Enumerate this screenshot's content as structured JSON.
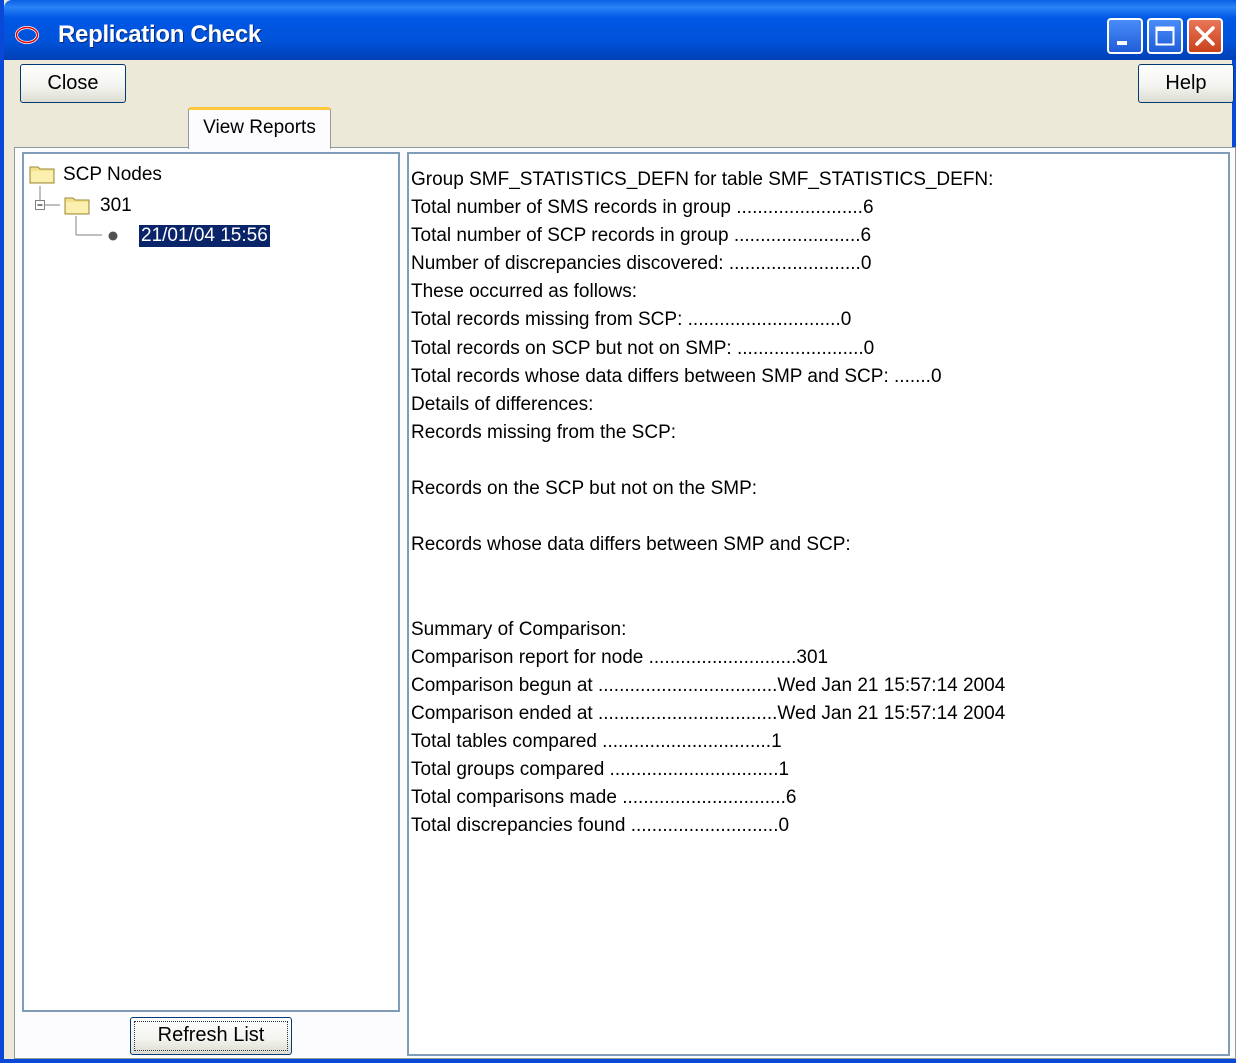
{
  "window": {
    "title": "Replication Check",
    "titlebar_color": "#0054e3"
  },
  "toolbar": {
    "close_label": "Close",
    "help_label": "Help"
  },
  "tabs": [
    {
      "label": "View Reports",
      "selected": true
    }
  ],
  "tree": {
    "root_label": "SCP Nodes",
    "node_label": "301",
    "report_label": "21/01/04 15:56",
    "selection_color": "#0a246a"
  },
  "refresh_label": "Refresh List",
  "report": {
    "lines": [
      "Group SMF_STATISTICS_DEFN for table SMF_STATISTICS_DEFN:",
      "Total number of SMS records in group ........................6",
      "Total number of SCP records in group ........................6",
      "Number of discrepancies discovered: .........................0",
      "These occurred as follows:",
      "Total records missing from SCP: .............................0",
      "Total records on SCP but not on SMP: ........................0",
      "Total records whose data differs between SMP and SCP: .......0",
      "Details of differences:",
      "Records missing from the SCP:",
      "",
      "Records on the SCP but not on the SMP:",
      "",
      "Records whose data differs between SMP and SCP:",
      "",
      "",
      "Summary of Comparison:",
      "Comparison report for node ............................301",
      "Comparison begun at ..................................Wed Jan 21 15:57:14 2004",
      "Comparison ended at ..................................Wed Jan 21 15:57:14 2004",
      "Total tables compared ................................1",
      "Total groups compared ................................1",
      "Total comparisons made ...............................6",
      "Total discrepancies found ............................0"
    ]
  }
}
